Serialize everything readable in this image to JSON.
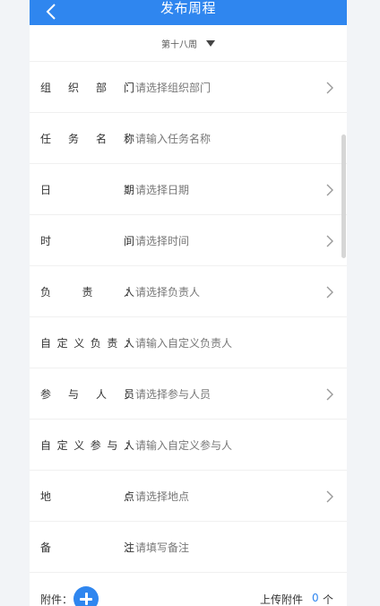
{
  "header": {
    "title": "发布周程"
  },
  "week": {
    "label": "第十八周"
  },
  "form": {
    "rows": [
      {
        "label": [
          "组",
          "织",
          "部",
          "门"
        ],
        "placeholder": "请选择组织部门",
        "chevron": true
      },
      {
        "label": [
          "任",
          "务",
          "名",
          "称"
        ],
        "placeholder": "请输入任务名称",
        "chevron": false
      },
      {
        "label": [
          "日",
          "期"
        ],
        "placeholder": "请选择日期",
        "chevron": true
      },
      {
        "label": [
          "时",
          "间"
        ],
        "placeholder": "请选择时间",
        "chevron": true
      },
      {
        "label": [
          "负",
          "责",
          "人"
        ],
        "placeholder": "请选择负责人",
        "chevron": true
      },
      {
        "label": [
          "自",
          "定",
          "义",
          "负",
          "责",
          "人"
        ],
        "placeholder": "请输入自定义负责人",
        "chevron": false
      },
      {
        "label": [
          "参",
          "与",
          "人",
          "员"
        ],
        "placeholder": "请选择参与人员",
        "chevron": true
      },
      {
        "label": [
          "自",
          "定",
          "义",
          "参",
          "与",
          "人"
        ],
        "placeholder": "请输入自定义参与人",
        "chevron": false
      },
      {
        "label": [
          "地",
          "点"
        ],
        "placeholder": "请选择地点",
        "chevron": true
      },
      {
        "label": [
          "备",
          "注"
        ],
        "placeholder": "请填写备注",
        "chevron": false
      }
    ],
    "colon": "："
  },
  "footer": {
    "attach_label": "附件：",
    "upload_label": "上传附件",
    "upload_count": "0",
    "upload_unit": "个"
  },
  "colors": {
    "accent": "#2f86ef"
  },
  "icons": {
    "back": "chevron-left-icon",
    "row": "chevron-right-icon",
    "dropdown": "caret-down-icon",
    "add": "plus-icon"
  }
}
